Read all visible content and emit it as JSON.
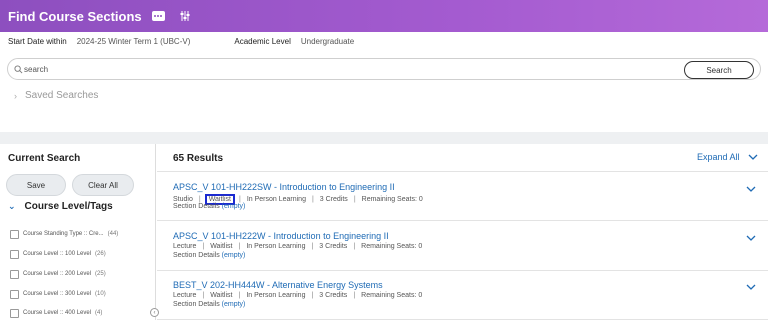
{
  "header": {
    "title": "Find Course Sections"
  },
  "criteria": {
    "start_date_label": "Start Date within",
    "start_date_value": "2024-25 Winter Term 1 (UBC-V)",
    "level_label": "Academic Level",
    "level_value": "Undergraduate"
  },
  "search": {
    "placeholder": "search",
    "value": "search",
    "button_label": "Search"
  },
  "saved_searches": "Saved Searches",
  "left_panel": {
    "title": "Current Search",
    "save_label": "Save",
    "clear_label": "Clear All",
    "facet_title": "Course Level/Tags",
    "facets": [
      {
        "label": "Course Standing Type :: Cre...",
        "count": "(44)"
      },
      {
        "label": "Course Level :: 100 Level",
        "count": "(26)"
      },
      {
        "label": "Course Level :: 200 Level",
        "count": "(25)"
      },
      {
        "label": "Course Level :: 300 Level",
        "count": "(10)"
      },
      {
        "label": "Course Level :: 400 Level",
        "count": "(4)"
      }
    ]
  },
  "results": {
    "count_label": "65 Results",
    "expand_all": "Expand All",
    "items": [
      {
        "title": "APSC_V 101-HH222SW - Introduction to Engineering II",
        "format": "Studio",
        "status": "Waitlist",
        "delivery": "In Person Learning",
        "credits": "3 Credits",
        "seats": "Remaining Seats: 0",
        "details_label": "Section Details",
        "details_value": "(empty)"
      },
      {
        "title": "APSC_V 101-HH222W - Introduction to Engineering II",
        "format": "Lecture",
        "status": "Waitlist",
        "delivery": "In Person Learning",
        "credits": "3 Credits",
        "seats": "Remaining Seats: 0",
        "details_label": "Section Details",
        "details_value": "(empty)"
      },
      {
        "title": "BEST_V 202-HH444W - Alternative Energy Systems",
        "format": "Lecture",
        "status": "Waitlist",
        "delivery": "In Person Learning",
        "credits": "3 Credits",
        "seats": "Remaining Seats: 0",
        "details_label": "Section Details",
        "details_value": "(empty)"
      }
    ]
  },
  "colors": {
    "header_start": "#8d4fbf",
    "header_end": "#b56ad9",
    "link": "#1f6bb5",
    "highlight": "#1b2ad1"
  }
}
